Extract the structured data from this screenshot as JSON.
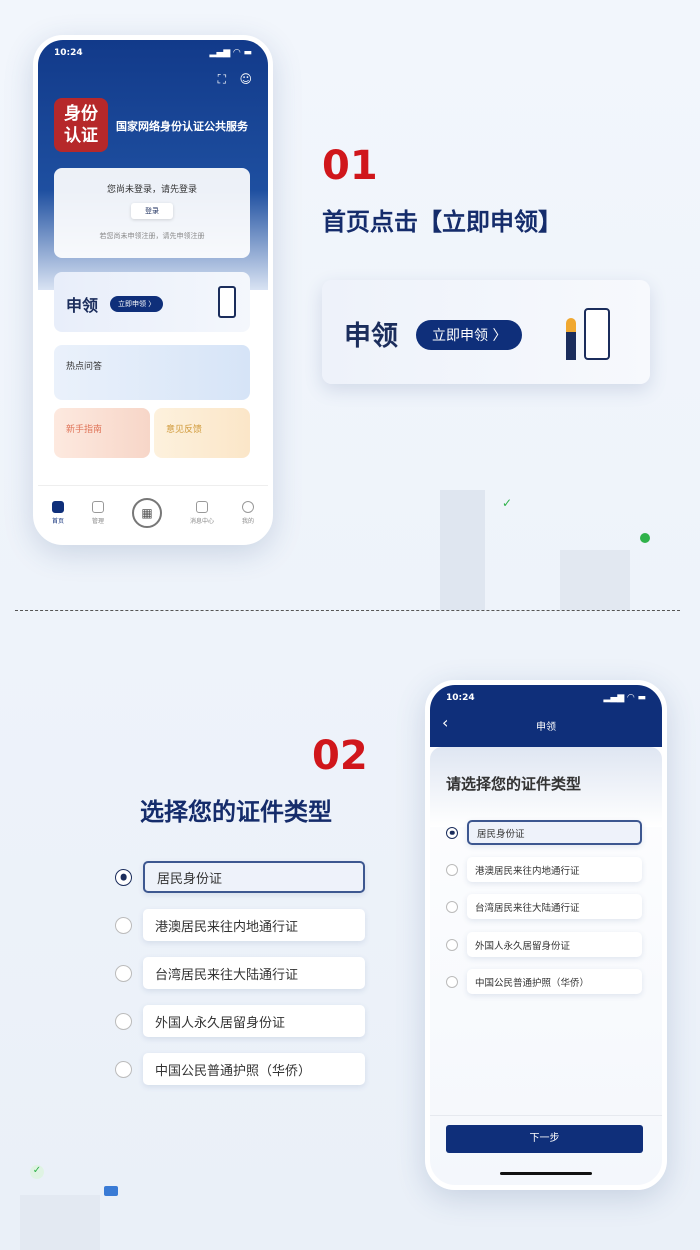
{
  "phone1": {
    "time": "10:24",
    "logo_line1": "身份",
    "logo_line2": "认证",
    "service_title": "国家网络身份认证公共服务",
    "login_prompt": "您尚未登录，请先登录",
    "login_button": "登录",
    "register_hint": "若您尚未申领注册，请先申领注册",
    "apply_title": "申领",
    "apply_button": "立即申领 〉",
    "faq": "热点问答",
    "guide": "新手指南",
    "feedback": "意见反馈",
    "nav": [
      {
        "label": "首页",
        "icon": "home-icon"
      },
      {
        "label": "管理",
        "icon": "clipboard-icon"
      },
      {
        "label": "",
        "icon": "qr-code-icon"
      },
      {
        "label": "消息中心",
        "icon": "message-icon"
      },
      {
        "label": "我的",
        "icon": "user-icon"
      }
    ]
  },
  "step1": {
    "number": "01",
    "title": "首页点击【立即申领】",
    "banner_title": "申领",
    "banner_button": "立即申领 〉"
  },
  "step2": {
    "number": "02",
    "title": "选择您的证件类型"
  },
  "options": [
    {
      "label": "居民身份证",
      "selected": true
    },
    {
      "label": "港澳居民来往内地通行证",
      "selected": false
    },
    {
      "label": "台湾居民来往大陆通行证",
      "selected": false
    },
    {
      "label": "外国人永久居留身份证",
      "selected": false
    },
    {
      "label": "中国公民普通护照（华侨）",
      "selected": false
    }
  ],
  "phone2": {
    "time": "10:24",
    "back": "‹",
    "title": "申领",
    "heading": "请选择您的证件类型",
    "next_button": "下一步"
  },
  "colors": {
    "primary": "#0f2f7a",
    "accent_red": "#d0161b",
    "logo_red": "#b6282a"
  }
}
